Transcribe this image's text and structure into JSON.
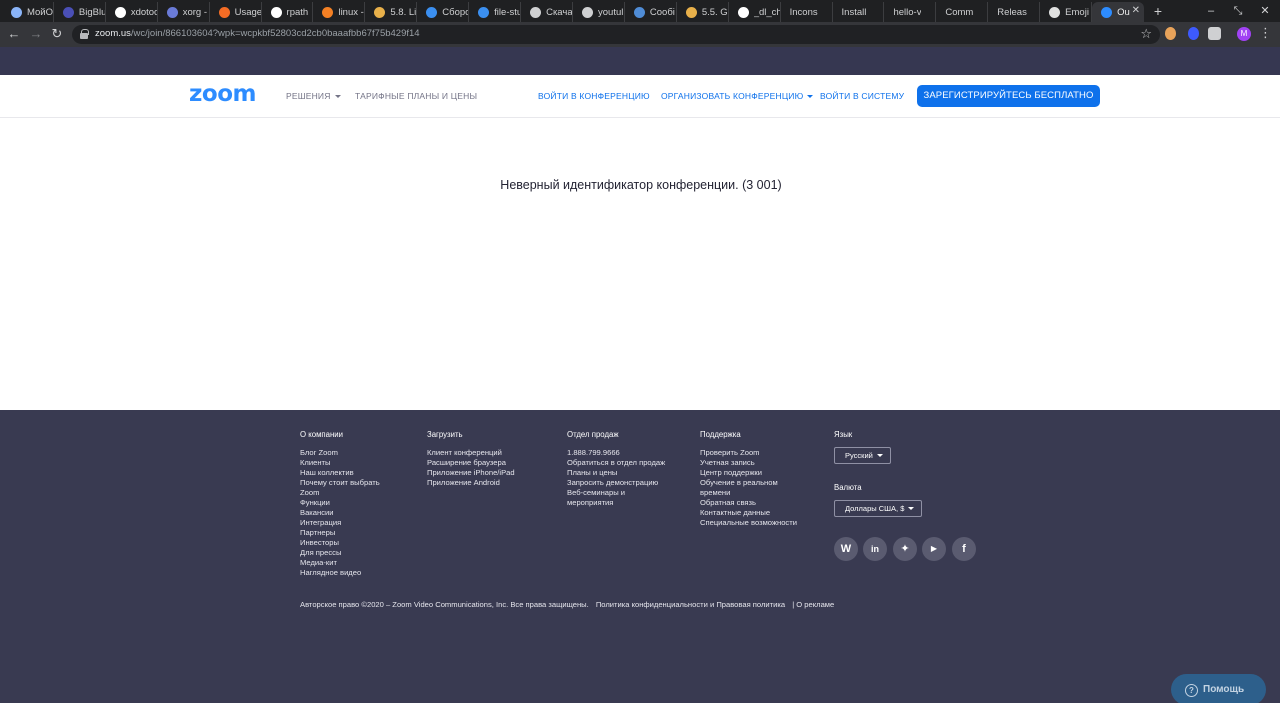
{
  "browser": {
    "tabs": [
      {
        "title": "МойО",
        "favicon": "globe-icon",
        "color": "#8ab4f8"
      },
      {
        "title": "BigBlu",
        "favicon": "b-icon",
        "color": "#4a4fb6"
      },
      {
        "title": "xdotoo",
        "favicon": "google-icon",
        "color": "#ffffff"
      },
      {
        "title": "xorg -",
        "favicon": "x-icon",
        "color": "#6a7bd8"
      },
      {
        "title": "Usage",
        "favicon": "github-icon",
        "color": "#f46c25"
      },
      {
        "title": "rpath",
        "favicon": "google-icon",
        "color": "#ffffff"
      },
      {
        "title": "linux -",
        "favicon": "stackexchange-icon",
        "color": "#f48024"
      },
      {
        "title": "5.8. Li",
        "favicon": "crab-icon",
        "color": "#e8b04a"
      },
      {
        "title": "Сборо",
        "favicon": "cube-icon",
        "color": "#3b8ff0"
      },
      {
        "title": "file-stu",
        "favicon": "cube-icon",
        "color": "#3b8ff0"
      },
      {
        "title": "Скача",
        "favicon": "download-icon",
        "color": "#cfd0d2"
      },
      {
        "title": "youtul",
        "favicon": "globe-icon",
        "color": "#cfd0d2"
      },
      {
        "title": "Сообі",
        "favicon": "chat-icon",
        "color": "#4f8cd6"
      },
      {
        "title": "5.5. G",
        "favicon": "crab-icon",
        "color": "#e8b04a"
      },
      {
        "title": "_dl_ch",
        "favicon": "google-icon",
        "color": "#ffffff"
      },
      {
        "title": "Incons",
        "favicon": "",
        "color": ""
      },
      {
        "title": "Install",
        "favicon": "",
        "color": ""
      },
      {
        "title": "hello-v",
        "favicon": "",
        "color": ""
      },
      {
        "title": "Comm",
        "favicon": "",
        "color": ""
      },
      {
        "title": "Releas",
        "favicon": "",
        "color": ""
      },
      {
        "title": "Emoji",
        "favicon": "window-icon",
        "color": "#e0e0e0"
      },
      {
        "title": "Ou",
        "favicon": "zoom-icon",
        "color": "#2d8cff",
        "active": true
      }
    ],
    "url_host": "zoom.us",
    "url_path": "/wc/join/866103604?wpk=wcpkbf52803cd2cb0baaafbb67f75b429f14",
    "avatar_letter": "M"
  },
  "header": {
    "logo": "zoom",
    "solutions": "РЕШЕНИЯ",
    "pricing": "ТАРИФНЫЕ ПЛАНЫ И ЦЕНЫ",
    "join": "ВОЙТИ В КОНФЕРЕНЦИЮ",
    "host": "ОРГАНИЗОВАТЬ КОНФЕРЕНЦИЮ",
    "signin": "ВОЙТИ В СИСТЕМУ",
    "signup": "ЗАРЕГИСТРИРУЙТЕСЬ БЕСПЛАТНО"
  },
  "main": {
    "error": "Неверный идентификатор конференции. (3 001)"
  },
  "footer": {
    "about": {
      "title": "О компании",
      "items": [
        "Блог Zoom",
        "Клиенты",
        "Наш коллектив",
        "Почему стоит выбрать",
        "Zoom",
        "Функции",
        "Вакансии",
        "Интеграция",
        "Партнеры",
        "Инвесторы",
        "Для прессы",
        "Медиа-кит",
        "Наглядное видео"
      ]
    },
    "download": {
      "title": "Загрузить",
      "items": [
        "Клиент конференций",
        "Расширение браузера",
        "Приложение iPhone/iPad",
        "Приложение Android"
      ]
    },
    "sales": {
      "title": "Отдел продаж",
      "items": [
        "1.888.799.9666",
        "Обратиться в отдел продаж",
        "Планы и цены",
        "Запросить демонстрацию",
        "Веб-семинары и",
        "мероприятия"
      ]
    },
    "support": {
      "title": "Поддержка",
      "items": [
        "Проверить Zoom",
        "Учетная запись",
        "Центр поддержки",
        "Обучение в реальном",
        "времени",
        "Обратная связь",
        "Контактные данные",
        "Специальные возможности"
      ]
    },
    "language": {
      "title": "Язык",
      "value": "Русский"
    },
    "currency": {
      "title": "Валюта",
      "value": "Доллары США, $"
    },
    "copyright": "Авторское право ©2020 – Zoom Video Communications, Inc. Все права защищены.",
    "policy": "Политика конфиденциальности и Правовая политика",
    "ads": "| О рекламе",
    "help": "Помощь"
  }
}
